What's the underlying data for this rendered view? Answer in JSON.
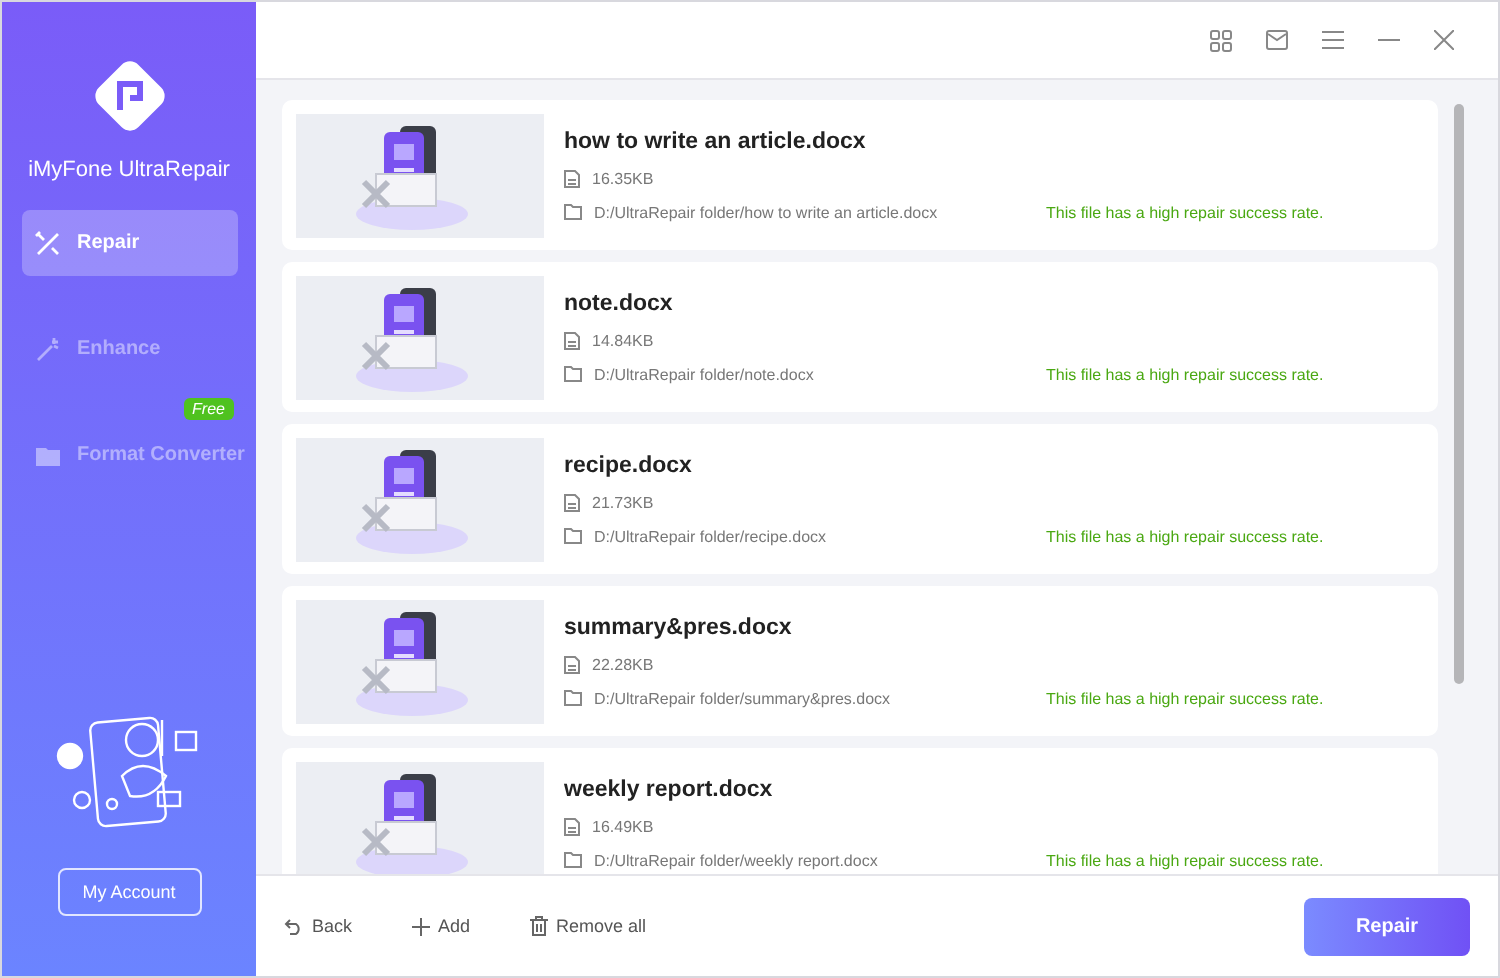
{
  "app": {
    "name": "iMyFone UltraRepair"
  },
  "nav": [
    {
      "label": "Repair",
      "selected": true
    },
    {
      "label": "Enhance",
      "selected": false
    },
    {
      "label": "Format Converter",
      "selected": false,
      "badge": "Free"
    }
  ],
  "account_button": "My Account",
  "files": [
    {
      "name": "how to write an article.docx",
      "size": "16.35KB",
      "path": "D:/UltraRepair folder/how to write an article.docx",
      "status": "This file has a high repair success rate."
    },
    {
      "name": "note.docx",
      "size": "14.84KB",
      "path": "D:/UltraRepair folder/note.docx",
      "status": "This file has a high repair success rate."
    },
    {
      "name": "recipe.docx",
      "size": "21.73KB",
      "path": "D:/UltraRepair folder/recipe.docx",
      "status": "This file has a high repair success rate."
    },
    {
      "name": "summary&pres.docx",
      "size": "22.28KB",
      "path": "D:/UltraRepair folder/summary&pres.docx",
      "status": "This file has a high repair success rate."
    },
    {
      "name": "weekly report.docx",
      "size": "16.49KB",
      "path": "D:/UltraRepair folder/weekly report.docx",
      "status": "This file has a high repair success rate."
    }
  ],
  "footer": {
    "back": "Back",
    "add": "Add",
    "remove_all": "Remove all",
    "repair": "Repair"
  }
}
